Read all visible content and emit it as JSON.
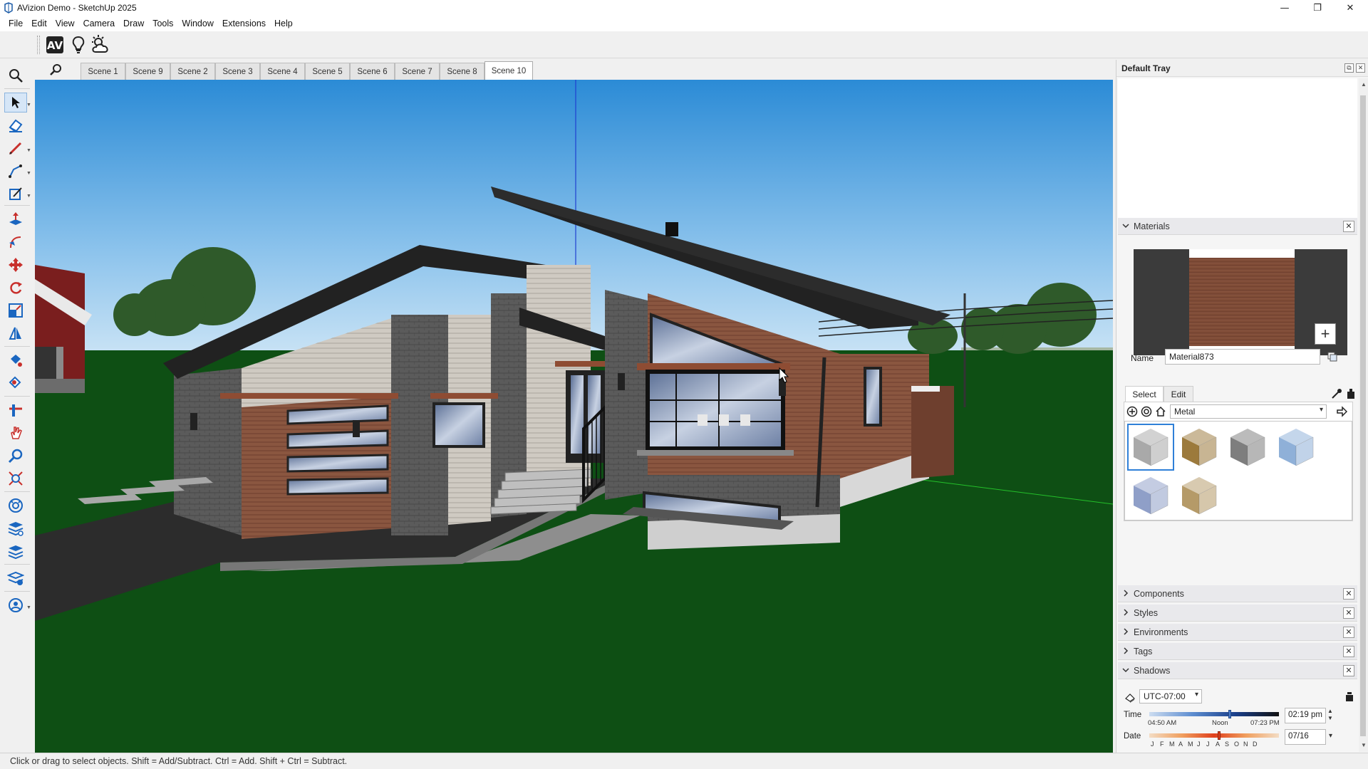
{
  "window": {
    "title": "AVizion Demo - SketchUp 2025",
    "minimize": "—",
    "maximize": "❐",
    "close": "✕"
  },
  "menu": [
    "File",
    "Edit",
    "View",
    "Camera",
    "Draw",
    "Tools",
    "Window",
    "Extensions",
    "Help"
  ],
  "top_toolbar": {
    "buttons": [
      "avizion-logo-icon",
      "lightbulb-icon",
      "weather-icon"
    ]
  },
  "left_toolbar": {
    "tools": [
      "zoom-icon",
      "select-icon",
      "eraser-icon",
      "pencil-icon",
      "arc-icon",
      "rectangle-icon",
      "push-pull-icon",
      "follow-me-icon",
      "move-icon",
      "rotate-icon",
      "scale-icon",
      "mirror-icon",
      "paint-bucket-icon",
      "paint-icon",
      "section-plane-icon",
      "orbit-hand-icon",
      "tape-measure-icon",
      "zoom-extents-icon",
      "sandbox-icon",
      "layers-icon",
      "stack-icon",
      "settings-icon",
      "user-icon"
    ]
  },
  "scene_tabs": {
    "tabs": [
      "Scene 1",
      "Scene 9",
      "Scene 2",
      "Scene 3",
      "Scene 4",
      "Scene 5",
      "Scene 6",
      "Scene 7",
      "Scene 8",
      "Scene 10"
    ],
    "active": "Scene 10"
  },
  "status": {
    "text": "Click or drag to select objects. Shift = Add/Subtract. Ctrl = Add. Shift + Ctrl = Subtract."
  },
  "tray": {
    "title": "Default Tray",
    "materials": {
      "label": "Materials",
      "name_label": "Name",
      "name_value": "Material873",
      "tab_select": "Select",
      "tab_edit": "Edit",
      "library": "Metal",
      "swatch_colors": [
        "#a9a9a9",
        "#9c7a3c",
        "#7e7e7e",
        "#8fb0d8",
        "#8f9fc8",
        "#b59a68"
      ]
    },
    "sections": [
      "Components",
      "Styles",
      "Environments",
      "Tags"
    ],
    "shadows": {
      "label": "Shadows",
      "timezone": "UTC-07:00",
      "time_label": "Time",
      "time_start": "04:50 AM",
      "time_mid": "Noon",
      "time_end": "07:23 PM",
      "time_value": "02:19 pm",
      "time_fraction": 0.62,
      "date_label": "Date",
      "months": [
        "J",
        "F",
        "M",
        "A",
        "M",
        "J",
        "J",
        "A",
        "S",
        "O",
        "N",
        "D"
      ],
      "date_value": "07/16",
      "date_fraction": 0.54
    }
  }
}
